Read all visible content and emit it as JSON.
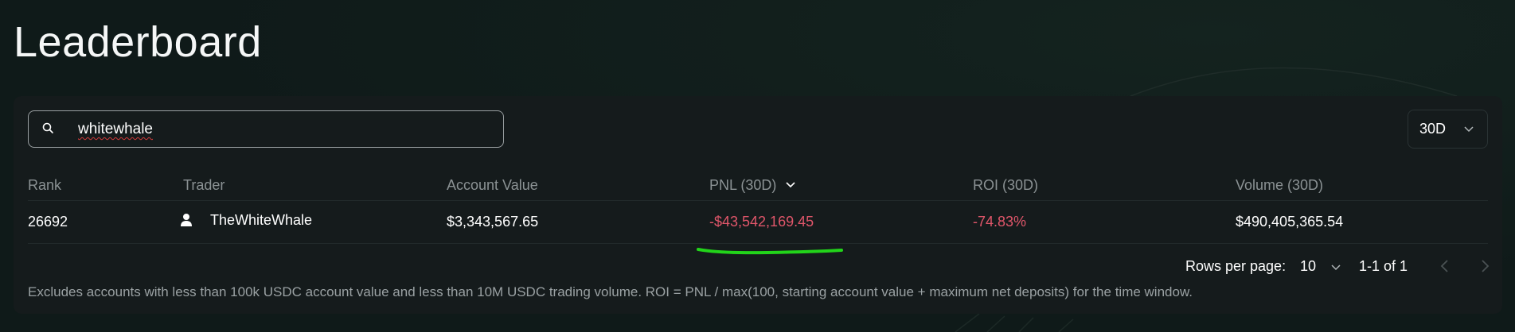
{
  "page": {
    "title": "Leaderboard"
  },
  "search": {
    "value": "whitewhale"
  },
  "period": {
    "value": "30D"
  },
  "table": {
    "headers": {
      "rank": "Rank",
      "trader": "Trader",
      "account_value": "Account Value",
      "pnl": "PNL (30D)",
      "roi": "ROI (30D)",
      "volume": "Volume (30D)"
    },
    "rows": [
      {
        "rank": "26692",
        "trader": "TheWhiteWhale",
        "account_value": "$3,343,567.65",
        "pnl": "-$43,542,169.45",
        "roi": "-74.83%",
        "volume": "$490,405,365.54"
      }
    ]
  },
  "pagination": {
    "rows_per_page_label": "Rows per page:",
    "rows_per_page": "10",
    "range": "1-1 of 1"
  },
  "footnote": "Excludes accounts with less than 100k USDC account value and less than 10M USDC trading volume. ROI = PNL / max(100, starting account value + maximum net deposits) for the time window.",
  "colors": {
    "negative": "#e0566a",
    "annotation": "#22d41a",
    "background": "#0f1a19",
    "card": "#151b1c"
  },
  "icons": [
    "search-icon",
    "chevron-down-icon",
    "user-icon",
    "chevron-left-icon",
    "chevron-right-icon"
  ]
}
